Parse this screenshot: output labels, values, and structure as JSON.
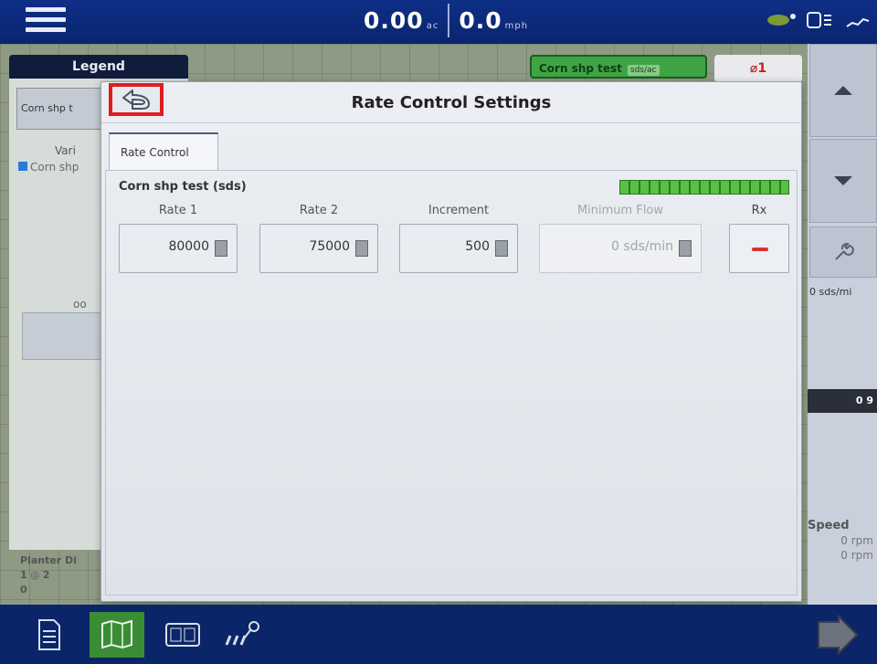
{
  "header": {
    "area_value": "0.00",
    "area_unit": "ac",
    "speed_value": "0.0",
    "speed_unit": "mph"
  },
  "legend": {
    "tab_label": "Legend",
    "product_button": "Corn shp t",
    "variety_label": "Vari",
    "legend_item": "Corn shp",
    "oo_label": "oo",
    "planter_label": "Planter Di",
    "planter_row": "1 ◎  2",
    "planter_sub": "0"
  },
  "run_screen": {
    "product_badge": "Corn shp test",
    "product_badge_unit": "sds/ac",
    "alarm_count": "⌀1",
    "right_flow": "0 sds/mi",
    "right_dark_value": "0 9",
    "speed_label": "Speed",
    "speed_rpm1": "0 rpm",
    "speed_rpm2": "0 rpm"
  },
  "modal": {
    "title": "Rate Control Settings",
    "tab_label": "Rate Control",
    "product_name": "Corn shp test (sds)",
    "fields": [
      {
        "label": "Rate 1",
        "value": "80000"
      },
      {
        "label": "Rate 2",
        "value": "75000"
      },
      {
        "label": "Increment",
        "value": "500"
      },
      {
        "label": "Minimum Flow",
        "value": "0 sds/min"
      }
    ],
    "rx_label": "Rx"
  },
  "icons": {
    "menu": "hamburger-menu-icon",
    "back": "back-arrow-icon",
    "keyboard": "keypad-icon",
    "up": "arrow-up-icon",
    "down": "arrow-down-icon",
    "wrench": "wrench-icon"
  },
  "colors": {
    "topbar": "#0e2f86",
    "back_highlight": "#e01d1d",
    "product_green": "#3fa444",
    "meter_green": "#58c044",
    "rx_dash": "#e03030"
  }
}
